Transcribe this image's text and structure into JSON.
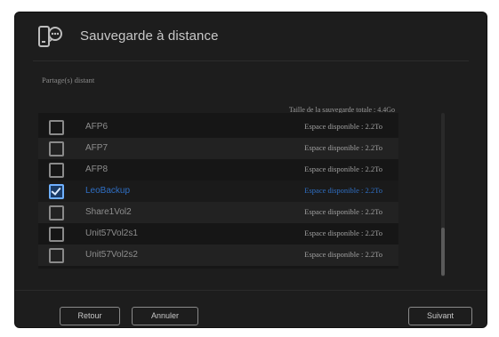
{
  "header": {
    "title": "Sauvegarde à distance",
    "icon": "remote-backup-icon"
  },
  "section": {
    "label": "Partage(s) distant"
  },
  "summary": {
    "total_size": "Taille de la sauvegarde totale : 4.4Go"
  },
  "shares": [
    {
      "name": "AFP6",
      "space": "Espace disponible : 2.2To",
      "checked": false
    },
    {
      "name": "AFP7",
      "space": "Espace disponible : 2.2To",
      "checked": false
    },
    {
      "name": "AFP8",
      "space": "Espace disponible : 2.2To",
      "checked": false
    },
    {
      "name": "LeoBackup",
      "space": "Espace disponible : 2.2To",
      "checked": true
    },
    {
      "name": "Share1Vol2",
      "space": "Espace disponible : 2.2To",
      "checked": false
    },
    {
      "name": "Unit57Vol2s1",
      "space": "Espace disponible : 2.2To",
      "checked": false
    },
    {
      "name": "Unit57Vol2s2",
      "space": "Espace disponible : 2.2To",
      "checked": false
    }
  ],
  "footer": {
    "back_label": "Retour",
    "cancel_label": "Annuler",
    "next_label": "Suivant"
  },
  "colors": {
    "background": "#1d1d1d",
    "accent": "#2f6fc4",
    "checkbox_checked": "#6fb0ff"
  }
}
